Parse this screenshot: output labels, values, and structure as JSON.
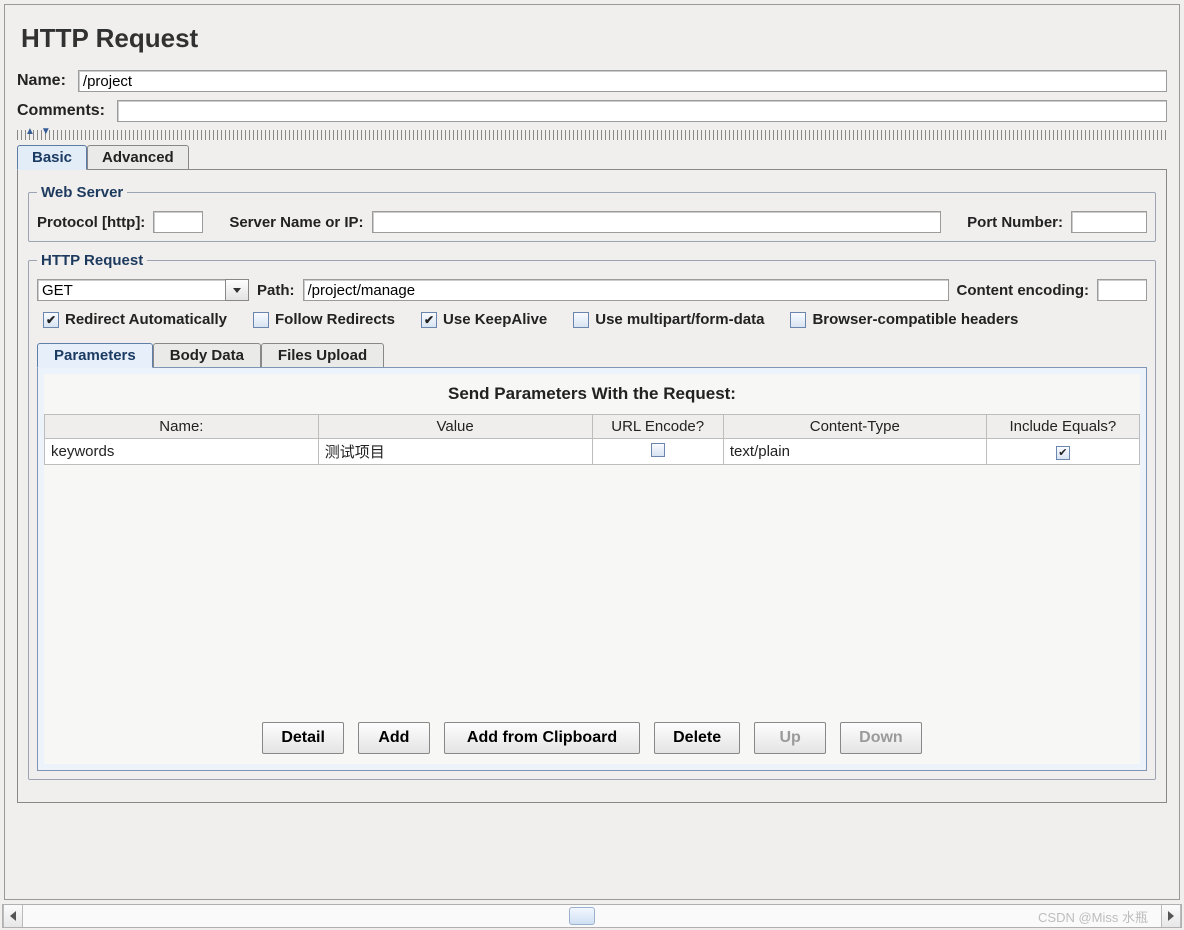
{
  "header": {
    "title": "HTTP Request",
    "name_label": "Name:",
    "name_value": "/project",
    "comments_label": "Comments:",
    "comments_value": ""
  },
  "tabs": {
    "basic": "Basic",
    "advanced": "Advanced",
    "active": "basic"
  },
  "web_server": {
    "legend": "Web Server",
    "protocol_label": "Protocol [http]:",
    "protocol_value": "",
    "server_label": "Server Name or IP:",
    "server_value": "",
    "port_label": "Port Number:",
    "port_value": ""
  },
  "http_request": {
    "legend": "HTTP Request",
    "method_value": "GET",
    "path_label": "Path:",
    "path_value": "/project/manage",
    "encoding_label": "Content encoding:",
    "encoding_value": "",
    "checkboxes": {
      "redirect_auto": {
        "label": "Redirect Automatically",
        "checked": true
      },
      "follow_redirects": {
        "label": "Follow Redirects",
        "checked": false
      },
      "keepalive": {
        "label": "Use KeepAlive",
        "checked": true
      },
      "multipart": {
        "label": "Use multipart/form-data",
        "checked": false
      },
      "browser_headers": {
        "label": "Browser-compatible headers",
        "checked": false
      }
    }
  },
  "param_tabs": {
    "parameters": "Parameters",
    "body_data": "Body Data",
    "files_upload": "Files Upload",
    "active": "parameters"
  },
  "params": {
    "title": "Send Parameters With the Request:",
    "columns": {
      "name": "Name:",
      "value": "Value",
      "url_encode": "URL Encode?",
      "content_type": "Content-Type",
      "include_equals": "Include Equals?"
    },
    "rows": [
      {
        "name": "keywords",
        "value": "测试项目",
        "url_encode": false,
        "content_type": "text/plain",
        "include_equals": true
      }
    ]
  },
  "buttons": {
    "detail": "Detail",
    "add": "Add",
    "add_clipboard": "Add from Clipboard",
    "delete": "Delete",
    "up": "Up",
    "down": "Down"
  },
  "watermark": "CSDN @Miss 水瓶"
}
